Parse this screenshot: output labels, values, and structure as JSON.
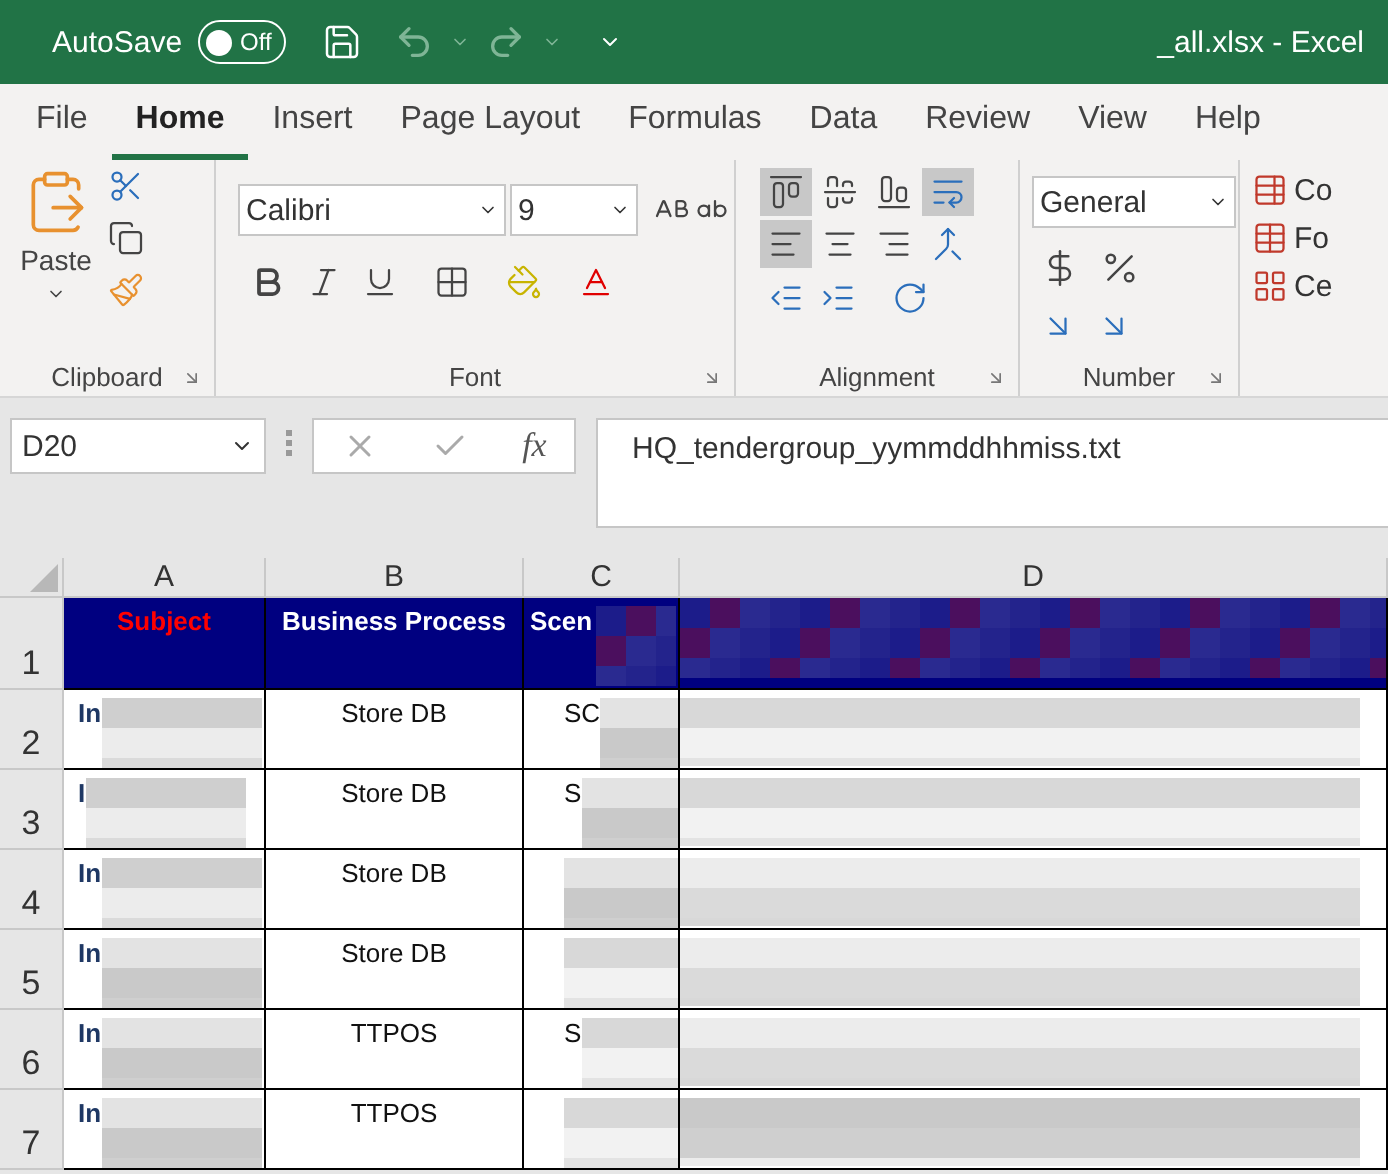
{
  "title_bar": {
    "autosave_label": "AutoSave",
    "autosave": {
      "on": false,
      "label": "Off"
    },
    "title": "_all.xlsx  -  Excel"
  },
  "tabs": [
    {
      "label": "File",
      "selected": false
    },
    {
      "label": "Home",
      "selected": true
    },
    {
      "label": "Insert",
      "selected": false
    },
    {
      "label": "Page Layout",
      "selected": false
    },
    {
      "label": "Formulas",
      "selected": false
    },
    {
      "label": "Data",
      "selected": false
    },
    {
      "label": "Review",
      "selected": false
    },
    {
      "label": "View",
      "selected": false
    },
    {
      "label": "Help",
      "selected": false
    }
  ],
  "ribbon": {
    "clipboard": {
      "title": "Clipboard",
      "paste": "Paste"
    },
    "font": {
      "title": "Font",
      "name": "Calibri",
      "size": "9"
    },
    "alignment": {
      "title": "Alignment",
      "buttons": [
        {
          "kind": "top",
          "selected": true
        },
        {
          "kind": "middle",
          "selected": false
        },
        {
          "kind": "bottom",
          "selected": false
        },
        {
          "kind": "wrap",
          "selected": true
        },
        {
          "kind": "left",
          "selected": true
        },
        {
          "kind": "center",
          "selected": false
        },
        {
          "kind": "right",
          "selected": false
        },
        {
          "kind": "merge",
          "selected": false
        }
      ]
    },
    "number": {
      "title": "Number",
      "format": "General"
    },
    "styles": [
      "Co",
      "Fo",
      "Ce"
    ]
  },
  "formula_bar": {
    "name_box": "D20",
    "fx": "fx",
    "value": "HQ_tendergroup_yymmddhhmiss.txt"
  },
  "sheet": {
    "columns": [
      "A",
      "B",
      "C",
      "D"
    ],
    "header": {
      "number": "1",
      "subject": "Subject",
      "process": "Business Process",
      "scenario": "Scen"
    },
    "rows": [
      {
        "number": "2",
        "subject": "In",
        "process": "Store DB",
        "scenario": "SC"
      },
      {
        "number": "3",
        "subject": "I",
        "process": "Store DB",
        "scenario": "S"
      },
      {
        "number": "4",
        "subject": "In",
        "process": "Store DB"
      },
      {
        "number": "5",
        "subject": "In",
        "process": "Store DB"
      },
      {
        "number": "6",
        "subject": "In",
        "process": "TTPOS",
        "scenario": "S"
      },
      {
        "number": "7",
        "subject": "In",
        "process": "TTPOS"
      }
    ]
  }
}
